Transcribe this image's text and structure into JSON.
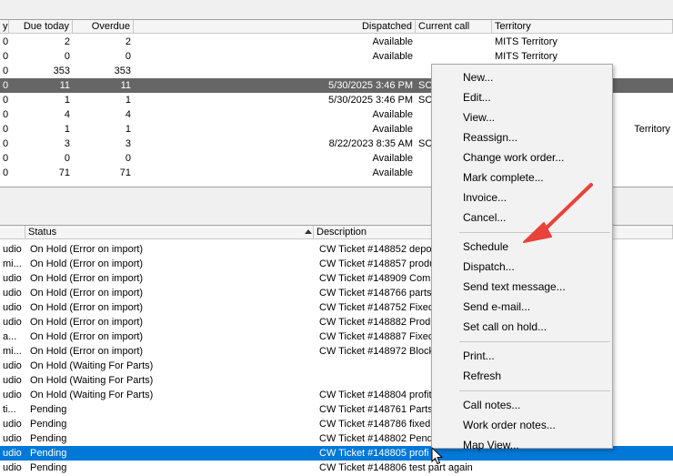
{
  "top_table": {
    "columns": [
      "y",
      "Due today",
      "Overdue",
      "Dispatched",
      "Current call",
      "Territory"
    ],
    "rows": [
      [
        "0",
        "2",
        "2",
        "Available",
        "",
        "MITS Territory"
      ],
      [
        "0",
        "0",
        "0",
        "Available",
        "",
        "MITS Territory"
      ],
      [
        "0",
        "353",
        "353",
        "",
        "",
        ""
      ],
      [
        "0",
        "11",
        "11",
        "5/30/2025 3:46 PM",
        "SC",
        ""
      ],
      [
        "0",
        "1",
        "1",
        "5/30/2025 3:46 PM",
        "SC",
        ""
      ],
      [
        "0",
        "4",
        "4",
        "Available",
        "",
        ""
      ],
      [
        "0",
        "1",
        "1",
        "Available",
        "",
        "Territory"
      ],
      [
        "0",
        "3",
        "3",
        "8/22/2023 8:35 AM",
        "SC",
        ""
      ],
      [
        "0",
        "0",
        "0",
        "Available",
        "",
        ""
      ],
      [
        "0",
        "71",
        "71",
        "Available",
        "",
        ""
      ]
    ]
  },
  "bottom_table": {
    "columns": [
      "",
      "Status",
      "Description"
    ],
    "rows": [
      [
        "udio",
        "On Hold (Error on import)",
        "CW Ticket #148852 depo"
      ],
      [
        "mi...",
        "On Hold (Error on import)",
        "CW Ticket #148857 produ"
      ],
      [
        "udio",
        "On Hold (Error on import)",
        "CW Ticket #148909 Comp"
      ],
      [
        "udio",
        "On Hold (Error on import)",
        "CW Ticket #148766 parts"
      ],
      [
        "udio",
        "On Hold (Error on import)",
        "CW Ticket #148752 Fixed"
      ],
      [
        "udio",
        "On Hold (Error on import)",
        "CW Ticket #148882 Produ"
      ],
      [
        "a...",
        "On Hold (Error on import)",
        "CW Ticket #148887 Fixed"
      ],
      [
        "mi...",
        "On Hold (Error on import)",
        "CW Ticket #148972 Block"
      ],
      [
        "udio",
        "On Hold (Waiting For Parts)",
        ""
      ],
      [
        "udio",
        "On Hold (Waiting For Parts)",
        ""
      ],
      [
        "udio",
        "On Hold (Waiting For Parts)",
        "CW Ticket #148804 profit"
      ],
      [
        "ti...",
        "Pending",
        "CW Ticket #148761 Parts"
      ],
      [
        "udio",
        "Pending",
        "CW Ticket #148786 fixed"
      ],
      [
        "udio",
        "Pending",
        "CW Ticket #148802 Pend"
      ],
      [
        "udio",
        "Pending",
        "CW Ticket #148805 profi"
      ],
      [
        "udio",
        "Pending",
        "CW Ticket #148806 test part again"
      ]
    ]
  },
  "context_menu": {
    "groups": [
      [
        "New...",
        "Edit...",
        "View...",
        "Reassign...",
        "Change work order...",
        "Mark complete...",
        "Invoice...",
        "Cancel..."
      ],
      [
        "Schedule",
        "Dispatch...",
        "Send text message...",
        "Send e-mail...",
        "Set call on hold..."
      ],
      [
        "Print...",
        "Refresh"
      ],
      [
        "Call notes...",
        "Work order notes...",
        "Map View..."
      ]
    ],
    "highlighted_item": "Schedule"
  },
  "colors": {
    "selected_row_dark": "#666666",
    "selected_row_blue": "#0078d7",
    "highlight_yellow": "#f6ec5b",
    "arrow_red": "#e8423a"
  },
  "icons": [
    "mouse-cursor-icon",
    "sort-ascending-icon",
    "annotation-arrow-icon"
  ]
}
